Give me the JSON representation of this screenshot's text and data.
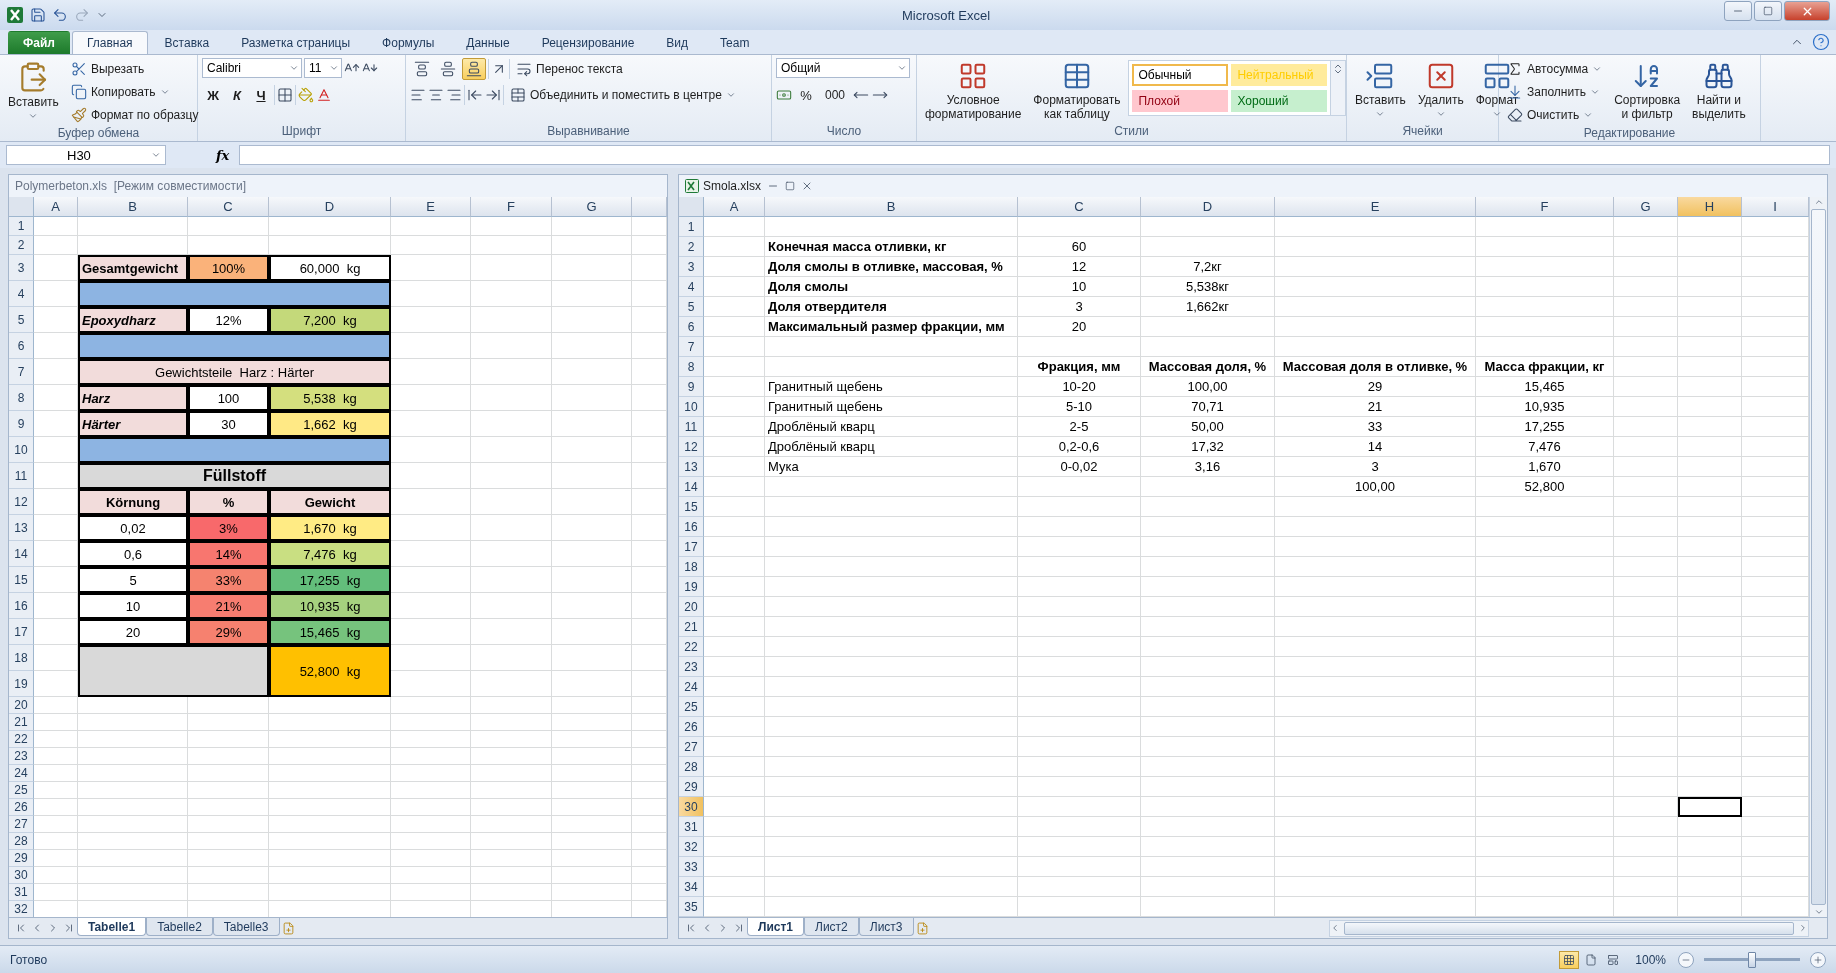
{
  "window": {
    "title": "Microsoft Excel"
  },
  "ribbon_tabs": [
    {
      "label": "Файл",
      "kind": "file",
      "selected": false
    },
    {
      "label": "Главная",
      "kind": "tab",
      "selected": true
    },
    {
      "label": "Вставка",
      "kind": "tab",
      "selected": false
    },
    {
      "label": "Разметка страницы",
      "kind": "tab",
      "selected": false
    },
    {
      "label": "Формулы",
      "kind": "tab",
      "selected": false
    },
    {
      "label": "Данные",
      "kind": "tab",
      "selected": false
    },
    {
      "label": "Рецензирование",
      "kind": "tab",
      "selected": false
    },
    {
      "label": "Вид",
      "kind": "tab",
      "selected": false
    },
    {
      "label": "Team",
      "kind": "tab",
      "selected": false
    }
  ],
  "clipboard": {
    "label": "Буфер обмена",
    "paste": "Вставить",
    "cut": "Вырезать",
    "copy": "Копировать",
    "painter": "Формат по образцу"
  },
  "font": {
    "label": "Шрифт",
    "family": "Calibri",
    "size": "11",
    "bold": "Ж",
    "italic": "К",
    "underline": "Ч"
  },
  "alignment": {
    "label": "Выравнивание",
    "wrap": "Перенос текста",
    "merge": "Объединить и поместить в центре",
    "vertical": [
      {
        "kind": "top",
        "selected": false
      },
      {
        "kind": "middle",
        "selected": false
      },
      {
        "kind": "bottom",
        "selected": true
      }
    ]
  },
  "number": {
    "label": "Число",
    "format": "Общий",
    "percent": "%",
    "thousands": "000"
  },
  "styles": {
    "label": "Стили",
    "conditional": [
      "Условное",
      "форматирование"
    ],
    "as_table": [
      "Форматировать",
      "как таблицу"
    ],
    "gallery": [
      {
        "label": "Обычный",
        "color": "#ffffff",
        "selected": true
      },
      {
        "label": "Нейтральный",
        "color": "#ffeb9c",
        "selected": false
      },
      {
        "label": "Плохой",
        "color": "#ffc7ce",
        "selected": false
      },
      {
        "label": "Хороший",
        "color": "#c6efce",
        "selected": false
      }
    ]
  },
  "cells": {
    "label": "Ячейки",
    "insert": "Вставить",
    "delete": "Удалить",
    "format": "Формат"
  },
  "editing": {
    "label": "Редактирование",
    "autosum": "Автосумма",
    "fill": "Заполнить",
    "clear": "Очистить",
    "sort": [
      "Сортировка",
      "и фильтр"
    ],
    "find": [
      "Найти и",
      "выделить"
    ]
  },
  "formula_bar": {
    "name_box": "H30",
    "fx": "fx"
  },
  "left_window": {
    "title": "Polymerbeton.xls  [Режим совместимости]",
    "columns": [
      "A",
      "B",
      "C",
      "D",
      "E",
      "F",
      "G"
    ],
    "rows": [
      "1",
      "2",
      "3",
      "4",
      "5",
      "6",
      "7",
      "8",
      "9",
      "10",
      "11",
      "12",
      "13",
      "14",
      "15",
      "16",
      "17",
      "18",
      "19",
      "20",
      "21",
      "22",
      "23",
      "24",
      "25",
      "26",
      "27",
      "28",
      "29",
      "30",
      "31",
      "32"
    ],
    "table": [
      {
        "cells": [
          {
            "text": "Gesamtgewicht",
            "kind": "label",
            "color": "#f2dcdb"
          },
          {
            "text": "100%",
            "kind": "value",
            "color": "#fab27a"
          },
          {
            "text": "60,000  kg",
            "kind": "value",
            "color": "#ffffff"
          }
        ]
      },
      {
        "cells": [
          {
            "kind": "band",
            "color": "#8db4e2"
          }
        ]
      },
      {
        "cells": [
          {
            "text": "Epoxydharz",
            "kind": "label-italic",
            "color": "#f2dcdb"
          },
          {
            "text": "12%",
            "kind": "value",
            "color": "#ffffff"
          },
          {
            "text": "7,200  kg",
            "kind": "value",
            "color": "#c4d97a"
          }
        ]
      },
      {
        "cells": [
          {
            "kind": "band",
            "color": "#8db4e2"
          }
        ]
      },
      {
        "cells": [
          {
            "text": "Gewichtsteile  Harz : Härter",
            "kind": "note",
            "color": "#f2dcdb"
          }
        ]
      },
      {
        "cells": [
          {
            "text": "Harz",
            "kind": "label-italic",
            "color": "#f2dcdb"
          },
          {
            "text": "100",
            "kind": "value",
            "color": "#ffffff"
          },
          {
            "text": "5,538  kg",
            "kind": "value",
            "color": "#d4df7e"
          }
        ]
      },
      {
        "cells": [
          {
            "text": "Härter",
            "kind": "label-italic",
            "color": "#f2dcdb"
          },
          {
            "text": "30",
            "kind": "value",
            "color": "#ffffff"
          },
          {
            "text": "1,662  kg",
            "kind": "value",
            "color": "#ffe985"
          }
        ]
      },
      {
        "cells": [
          {
            "kind": "band",
            "color": "#8db4e2"
          }
        ]
      },
      {
        "cells": [
          {
            "text": "Füllstoff",
            "kind": "heading",
            "color": "#d9d9d9"
          }
        ]
      },
      {
        "cells": [
          {
            "text": "Körnung",
            "kind": "header",
            "color": "#f2dcdb"
          },
          {
            "text": "%",
            "kind": "header",
            "color": "#f2dcdb"
          },
          {
            "text": "Gewicht",
            "kind": "header",
            "color": "#f2dcdb"
          }
        ]
      },
      {
        "cells": [
          {
            "text": "0,02",
            "kind": "value",
            "color": "#ffffff"
          },
          {
            "text": "3%",
            "kind": "value",
            "color": "#f8696b"
          },
          {
            "text": "1,670  kg",
            "kind": "value",
            "color": "#ffeb84"
          }
        ]
      },
      {
        "cells": [
          {
            "text": "0,6",
            "kind": "value",
            "color": "#ffffff"
          },
          {
            "text": "14%",
            "kind": "value",
            "color": "#f8766f"
          },
          {
            "text": "7,476  kg",
            "kind": "value",
            "color": "#c9df82"
          }
        ]
      },
      {
        "cells": [
          {
            "text": "5",
            "kind": "value",
            "color": "#ffffff"
          },
          {
            "text": "33%",
            "kind": "value",
            "color": "#f5836f"
          },
          {
            "text": "17,255  kg",
            "kind": "value",
            "color": "#63be7b"
          }
        ]
      },
      {
        "cells": [
          {
            "text": "10",
            "kind": "value",
            "color": "#ffffff"
          },
          {
            "text": "21%",
            "kind": "value",
            "color": "#f77d70"
          },
          {
            "text": "10,935  kg",
            "kind": "value",
            "color": "#a6d17f"
          }
        ]
      },
      {
        "cells": [
          {
            "text": "20",
            "kind": "value",
            "color": "#ffffff"
          },
          {
            "text": "29%",
            "kind": "value",
            "color": "#f6816f"
          },
          {
            "text": "15,465  kg",
            "kind": "value",
            "color": "#76c37d"
          }
        ]
      },
      {
        "cells": [
          {
            "kind": "spacer",
            "color": "#d9d9d9"
          },
          {
            "text": "52,800  kg",
            "kind": "total",
            "color": "#ffc000"
          }
        ]
      }
    ],
    "sheets": [
      {
        "label": "Tabelle1",
        "selected": true
      },
      {
        "label": "Tabelle2",
        "selected": false
      },
      {
        "label": "Tabelle3",
        "selected": false
      }
    ]
  },
  "right_window": {
    "title": "Smola.xlsx",
    "columns": [
      {
        "label": "A",
        "selected": false
      },
      {
        "label": "B",
        "selected": false
      },
      {
        "label": "C",
        "selected": false
      },
      {
        "label": "D",
        "selected": false
      },
      {
        "label": "E",
        "selected": false
      },
      {
        "label": "F",
        "selected": false
      },
      {
        "label": "G",
        "selected": false
      },
      {
        "label": "H",
        "selected": true
      },
      {
        "label": "I",
        "selected": false
      }
    ],
    "rows": [
      {
        "label": "1",
        "selected": false
      },
      {
        "label": "2",
        "selected": false,
        "cells": [
          null,
          {
            "text": "Конечная масса отливки, кг",
            "kind": "label"
          },
          {
            "text": "60",
            "kind": "number"
          }
        ]
      },
      {
        "label": "3",
        "selected": false,
        "cells": [
          null,
          {
            "text": "Доля смолы в отливке, массовая, %",
            "kind": "label"
          },
          {
            "text": "12",
            "kind": "number"
          },
          {
            "text": "7,2кг",
            "kind": "number"
          }
        ]
      },
      {
        "label": "4",
        "selected": false,
        "cells": [
          null,
          {
            "text": "Доля смолы",
            "kind": "label"
          },
          {
            "text": "10",
            "kind": "number"
          },
          {
            "text": "5,538кг",
            "kind": "number"
          }
        ]
      },
      {
        "label": "5",
        "selected": false,
        "cells": [
          null,
          {
            "text": "Доля отвердителя",
            "kind": "label"
          },
          {
            "text": "3",
            "kind": "number"
          },
          {
            "text": "1,662кг",
            "kind": "number"
          }
        ]
      },
      {
        "label": "6",
        "selected": false,
        "cells": [
          null,
          {
            "text": "Максимальный размер фракции, мм",
            "kind": "label"
          },
          {
            "text": "20",
            "kind": "number"
          }
        ]
      },
      {
        "label": "7",
        "selected": false
      },
      {
        "label": "8",
        "selected": false,
        "cells": [
          null,
          null,
          {
            "text": "Фракция, мм",
            "kind": "header"
          },
          {
            "text": "Массовая доля, %",
            "kind": "header"
          },
          {
            "text": "Массовая доля в отливке, %",
            "kind": "header"
          },
          {
            "text": "Масса фракции, кг",
            "kind": "header"
          }
        ]
      },
      {
        "label": "9",
        "selected": false,
        "cells": [
          null,
          {
            "text": "Гранитный щебень",
            "kind": "text"
          },
          {
            "text": "10-20",
            "kind": "number"
          },
          {
            "text": "100,00",
            "kind": "number"
          },
          {
            "text": "29",
            "kind": "number"
          },
          {
            "text": "15,465",
            "kind": "number"
          }
        ]
      },
      {
        "label": "10",
        "selected": false,
        "cells": [
          null,
          {
            "text": "Гранитный щебень",
            "kind": "text"
          },
          {
            "text": "5-10",
            "kind": "number"
          },
          {
            "text": "70,71",
            "kind": "number"
          },
          {
            "text": "21",
            "kind": "number"
          },
          {
            "text": "10,935",
            "kind": "number"
          }
        ]
      },
      {
        "label": "11",
        "selected": false,
        "cells": [
          null,
          {
            "text": "Дроблёный кварц",
            "kind": "text"
          },
          {
            "text": "2-5",
            "kind": "number"
          },
          {
            "text": "50,00",
            "kind": "number"
          },
          {
            "text": "33",
            "kind": "number"
          },
          {
            "text": "17,255",
            "kind": "number"
          }
        ]
      },
      {
        "label": "12",
        "selected": false,
        "cells": [
          null,
          {
            "text": "Дроблёный кварц",
            "kind": "text"
          },
          {
            "text": "0,2-0,6",
            "kind": "number"
          },
          {
            "text": "17,32",
            "kind": "number"
          },
          {
            "text": "14",
            "kind": "number"
          },
          {
            "text": "7,476",
            "kind": "number"
          }
        ]
      },
      {
        "label": "13",
        "selected": false,
        "cells": [
          null,
          {
            "text": "Мука",
            "kind": "text"
          },
          {
            "text": "0-0,02",
            "kind": "number"
          },
          {
            "text": "3,16",
            "kind": "number"
          },
          {
            "text": "3",
            "kind": "number"
          },
          {
            "text": "1,670",
            "kind": "number"
          }
        ]
      },
      {
        "label": "14",
        "selected": false,
        "cells": [
          null,
          null,
          null,
          null,
          {
            "text": "100,00",
            "kind": "number"
          },
          {
            "text": "52,800",
            "kind": "number"
          }
        ]
      },
      {
        "label": "15",
        "selected": false
      },
      {
        "label": "16",
        "selected": false
      },
      {
        "label": "17",
        "selected": false
      },
      {
        "label": "18",
        "selected": false
      },
      {
        "label": "19",
        "selected": false
      },
      {
        "label": "20",
        "selected": false
      },
      {
        "label": "21",
        "selected": false
      },
      {
        "label": "22",
        "selected": false
      },
      {
        "label": "23",
        "selected": false
      },
      {
        "label": "24",
        "selected": false
      },
      {
        "label": "25",
        "selected": false
      },
      {
        "label": "26",
        "selected": false
      },
      {
        "label": "27",
        "selected": false
      },
      {
        "label": "28",
        "selected": false
      },
      {
        "label": "29",
        "selected": false
      },
      {
        "label": "30",
        "selected": true
      },
      {
        "label": "31",
        "selected": false
      },
      {
        "label": "32",
        "selected": false
      },
      {
        "label": "33",
        "selected": false
      },
      {
        "label": "34",
        "selected": false
      },
      {
        "label": "35",
        "selected": false
      }
    ],
    "sheets": [
      {
        "label": "Лист1",
        "selected": true
      },
      {
        "label": "Лист2",
        "selected": false
      },
      {
        "label": "Лист3",
        "selected": false
      }
    ]
  },
  "status_bar": {
    "text": "Готово",
    "views": [
      {
        "kind": "normal",
        "selected": true
      },
      {
        "kind": "page-layout",
        "selected": false
      },
      {
        "kind": "page-break",
        "selected": false
      }
    ],
    "zoom": "100%",
    "zoom_slider": {
      "level": 0.5
    }
  }
}
